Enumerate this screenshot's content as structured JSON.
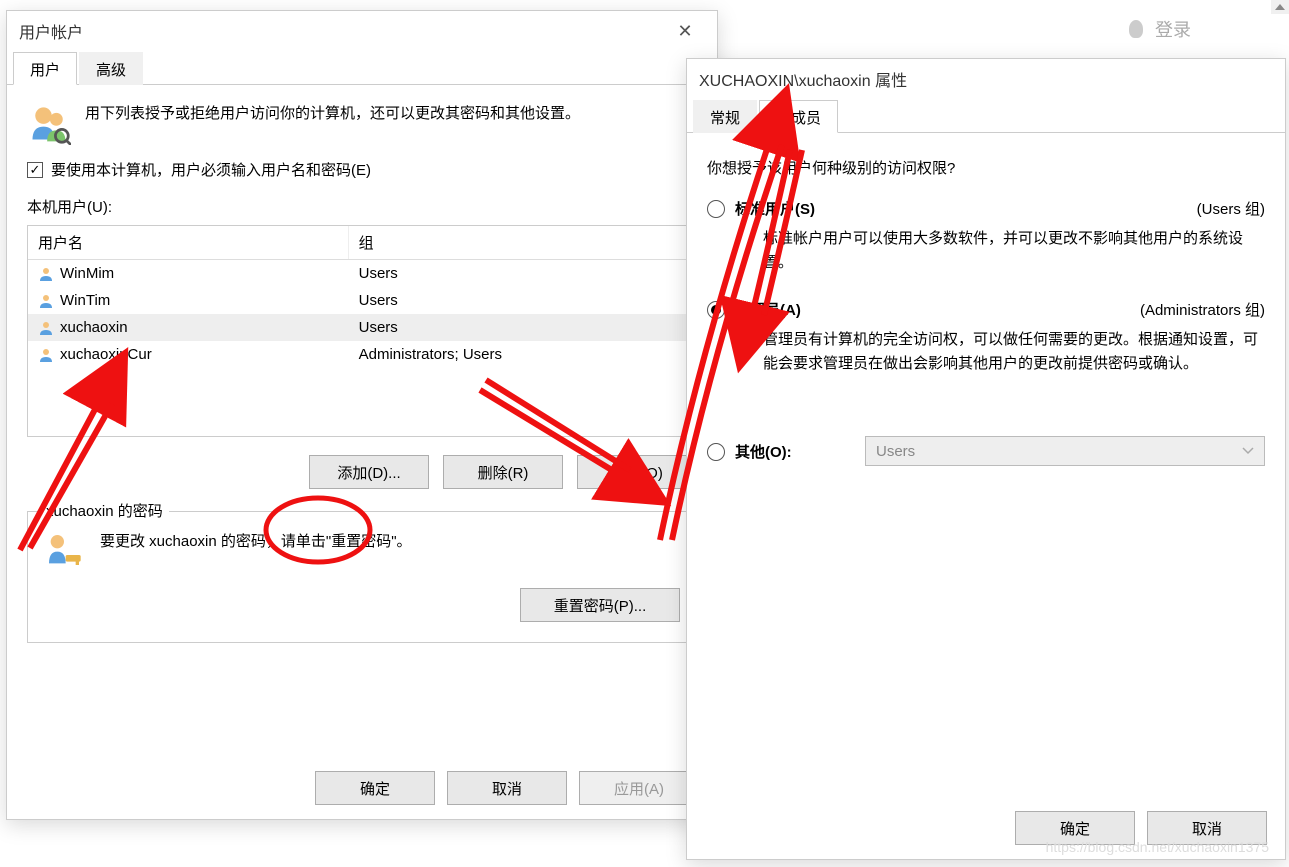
{
  "bg": {
    "login": "登录",
    "watermark": "https://blog.csdn.net/xuchaoxin1375"
  },
  "win1": {
    "title": "用户帐户",
    "tabs": {
      "users": "用户",
      "advanced": "高级"
    },
    "desc": "用下列表授予或拒绝用户访问你的计算机，还可以更改其密码和其他设置。",
    "checkbox": "要使用本计算机，用户必须输入用户名和密码(E)",
    "listlabel": "本机用户(U):",
    "cols": {
      "user": "用户名",
      "group": "组"
    },
    "rows": [
      {
        "name": "WinMim",
        "group": "Users",
        "sel": false
      },
      {
        "name": "WinTim",
        "group": "Users",
        "sel": false
      },
      {
        "name": "xuchaoxin",
        "group": "Users",
        "sel": true
      },
      {
        "name": "xuchaoxinCur",
        "group": "Administrators; Users",
        "sel": false
      }
    ],
    "btns": {
      "add": "添加(D)...",
      "del": "删除(R)",
      "prop": "属性(O)"
    },
    "passtitle": "xuchaoxin 的密码",
    "passdesc": "要更改 xuchaoxin 的密码，请单击\"重置密码\"。",
    "resetpw": "重置密码(P)...",
    "footer": {
      "ok": "确定",
      "cancel": "取消",
      "apply": "应用(A)"
    }
  },
  "win2": {
    "title": "XUCHAOXIN\\xuchaoxin 属性",
    "tabs": {
      "general": "常规",
      "member": "组成员"
    },
    "question": "你想授予该用户何种级别的访问权限?",
    "opt_std": {
      "label": "标准用户(S)",
      "group": "(Users 组)",
      "desc": "标准帐户用户可以使用大多数软件，并可以更改不影响其他用户的系统设置。"
    },
    "opt_admin": {
      "label": "管理员(A)",
      "group": "(Administrators 组)",
      "desc": "管理员有计算机的完全访问权，可以做任何需要的更改。根据通知设置，可能会要求管理员在做出会影响其他用户的更改前提供密码或确认。"
    },
    "opt_other": {
      "label": "其他(O):",
      "combo": "Users"
    },
    "footer": {
      "ok": "确定",
      "cancel": "取消"
    }
  }
}
